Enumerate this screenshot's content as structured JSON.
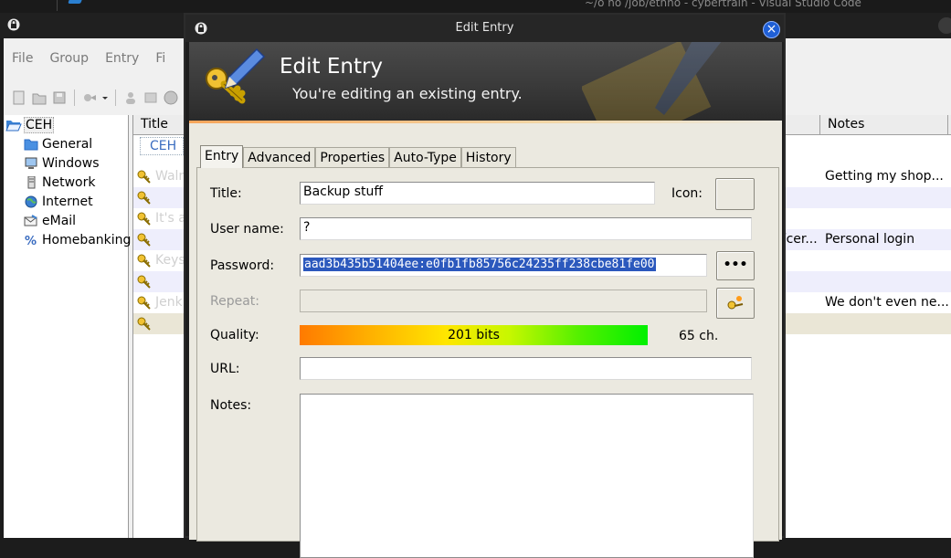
{
  "vscode_title": "~/o ho /job/ethno - cybertrain - Visual Studio Code",
  "main_menu": [
    "File",
    "Group",
    "Entry",
    "Fi"
  ],
  "tree": {
    "root": "CEH",
    "groups": [
      "General",
      "Windows",
      "Network",
      "Internet",
      "eMail",
      "Homebanking"
    ]
  },
  "list": {
    "columns": {
      "title": "Title",
      "notes": "Notes"
    },
    "group_tag": "CEH",
    "rows": [
      {
        "ghost": "Walm",
        "tail": "",
        "notes": "Getting my shop..."
      },
      {
        "ghost": "",
        "tail": "",
        "notes": ""
      },
      {
        "ghost": "It's a",
        "tail": "",
        "notes": ""
      },
      {
        "ghost": "",
        "tail": "Vcer...",
        "notes": "Personal login"
      },
      {
        "ghost": "Keys",
        "tail": "",
        "notes": ""
      },
      {
        "ghost": "",
        "tail": "",
        "notes": ""
      },
      {
        "ghost": "Jenk",
        "tail": "",
        "notes": "We don't even ne..."
      },
      {
        "ghost": "",
        "tail": "",
        "notes": ""
      }
    ]
  },
  "dialog": {
    "window_title": "Edit Entry",
    "banner_title": "Edit Entry",
    "banner_subtitle": "You're editing an existing entry.",
    "tabs": [
      "Entry",
      "Advanced",
      "Properties",
      "Auto-Type",
      "History"
    ],
    "active_tab": "Entry",
    "labels": {
      "title": "Title:",
      "icon": "Icon:",
      "username": "User name:",
      "password": "Password:",
      "repeat": "Repeat:",
      "quality": "Quality:",
      "url": "URL:",
      "notes": "Notes:"
    },
    "values": {
      "title": "Backup stuff",
      "username": "?",
      "password": "aad3b435b51404ee:e0fb1fb85756c24235ff238cbe81fe00",
      "repeat": "",
      "url": "",
      "notes": ""
    },
    "quality_text": "201 bits",
    "quality_fraction": 1.0,
    "char_count": "65 ch.",
    "show_password_button": "•••"
  }
}
